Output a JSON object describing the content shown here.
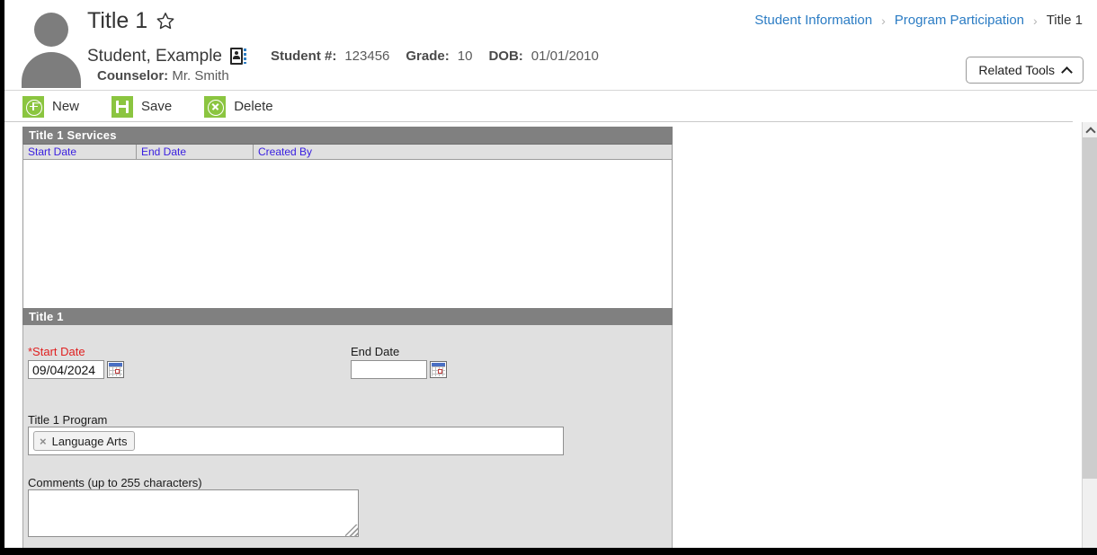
{
  "header": {
    "page_title": "Title 1",
    "favorite_icon": "star-icon",
    "student_name": "Student, Example",
    "contact_icon": "contact-card-icon",
    "student_number_label": "Student #:",
    "student_number": "123456",
    "grade_label": "Grade:",
    "grade": "10",
    "dob_label": "DOB:",
    "dob": "01/01/2010",
    "counselor_label": "Counselor:",
    "counselor": "Mr. Smith",
    "breadcrumb": {
      "item1": "Student Information",
      "sep1": "›",
      "item2": "Program Participation",
      "sep2": "›",
      "current": "Title 1"
    },
    "related_tools_label": "Related Tools"
  },
  "toolbar": {
    "new_label": "New",
    "save_label": "Save",
    "delete_label": "Delete"
  },
  "services_panel": {
    "section_title": "Title 1 Services",
    "columns": [
      "Start Date",
      "End Date",
      "Created By"
    ],
    "rows": []
  },
  "detail_panel": {
    "section_title": "Title 1",
    "start_date_label": "*Start Date",
    "start_date_value": "09/04/2024",
    "end_date_label": "End Date",
    "end_date_value": "",
    "program_label": "Title 1 Program",
    "program_chips": [
      "Language Arts"
    ],
    "chip_remove_icon": "×",
    "comments_label": "Comments (up to 255 characters)",
    "comments_value": ""
  },
  "colors": {
    "accent_green": "#8bc540",
    "link_blue": "#2b7cc4",
    "header_gray": "#808080",
    "grid_header_text": "#3a20e0",
    "required_red": "#e02020",
    "panel_bg": "#e0e0e0"
  }
}
